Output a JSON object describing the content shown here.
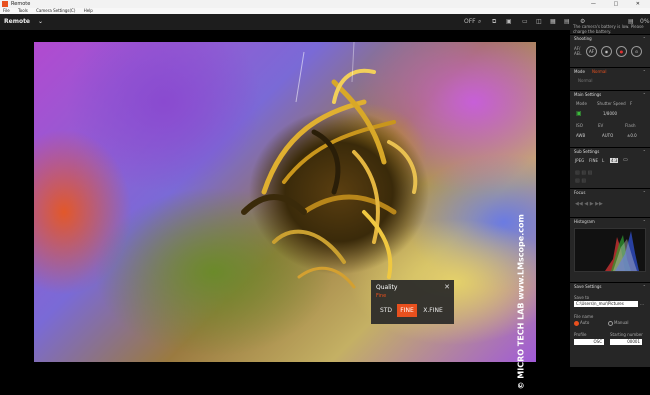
{
  "window": {
    "title": "Remote",
    "controls": "— □ ✕"
  },
  "menu": [
    "File",
    "Tools",
    "Camera Settings(C)",
    "Help"
  ],
  "toolbar": {
    "app_label": "Remote",
    "chevron": "⌄",
    "right_icons": [
      "OFF",
      "⌕",
      "⧉",
      "▣",
      "▭",
      "◫",
      "▦",
      "▤",
      "⚙"
    ],
    "battery_percent": "0%"
  },
  "watermark": "© MICRO TECH LAB www.LMscope.com",
  "quality_popup": {
    "title": "Quality",
    "current": "Fine",
    "close": "✕",
    "options": [
      "STD",
      "FINE",
      "X.FINE"
    ],
    "selected": "FINE"
  },
  "panel": {
    "warning": "The camera's battery is low. Please charge the battery.",
    "shooting": {
      "header": "Shooting",
      "af_label": "AF/ AEL",
      "buttons": [
        "AF",
        "◉",
        "●",
        "⊙"
      ]
    },
    "mode": {
      "header": "Mode",
      "mode_value": "Normal",
      "sub": "Normal"
    },
    "main_settings": {
      "header": "Main Settings",
      "labels": [
        "Mode",
        "Shutter Speed",
        "F"
      ],
      "shutter_value": "1/8000",
      "iso_label": "ISO",
      "ev_label": "EV",
      "flash_label": "Flash",
      "values_row": [
        "AWB",
        "AUTO",
        "±0.0"
      ]
    },
    "sub_settings": {
      "header": "Sub Settings",
      "items": [
        "JPEG",
        "FINE",
        "L",
        "4:3",
        "▭"
      ]
    },
    "focus": {
      "header": "Focus"
    },
    "histogram": {
      "header": "Histogram"
    },
    "save_settings": {
      "header": "Save Settings",
      "save_in_label": "Save to",
      "save_path": "C:\\Users\\n_mur\\Pictures",
      "file_name_label": "File name",
      "radio_auto": "Auto",
      "radio_manual": "Manual",
      "profile_label": "Profile",
      "profile_value": "OSC",
      "starting_number_label": "Starting number",
      "starting_number_value": "00001"
    }
  }
}
